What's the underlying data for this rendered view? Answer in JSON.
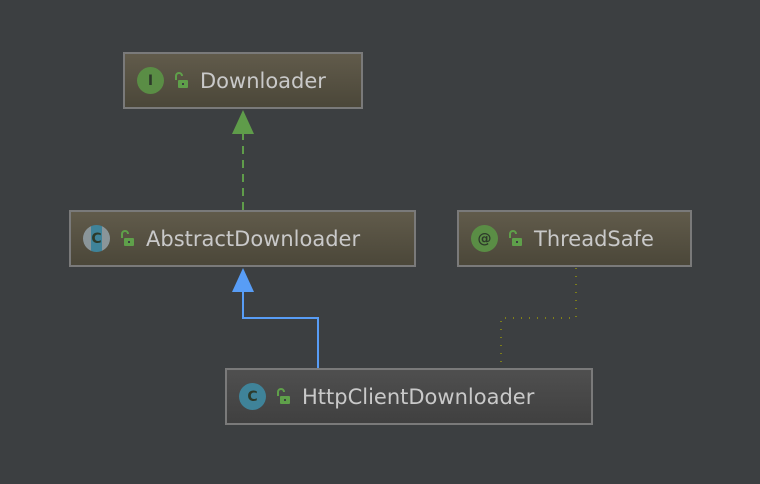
{
  "nodes": {
    "downloader": {
      "name": "Downloader",
      "kind": "interface",
      "badge": "I"
    },
    "abstract_downloader": {
      "name": "AbstractDownloader",
      "kind": "abstract-class",
      "badge": "C"
    },
    "thread_safe": {
      "name": "ThreadSafe",
      "kind": "annotation",
      "badge": "@"
    },
    "http_client_downloader": {
      "name": "HttpClientDownloader",
      "kind": "class",
      "badge": "C"
    }
  },
  "edges": [
    {
      "from": "AbstractDownloader",
      "to": "Downloader",
      "type": "implements",
      "color": "#5f9c4a"
    },
    {
      "from": "HttpClientDownloader",
      "to": "AbstractDownloader",
      "type": "extends",
      "color": "#589df6"
    },
    {
      "from": "HttpClientDownloader",
      "to": "ThreadSafe",
      "type": "annotated",
      "color": "#b8b800"
    }
  ],
  "colors": {
    "background": "#3c3f41",
    "interface_badge": "#5a8d45",
    "class_badge": "#3f8399",
    "lock": "#5fa04a"
  }
}
